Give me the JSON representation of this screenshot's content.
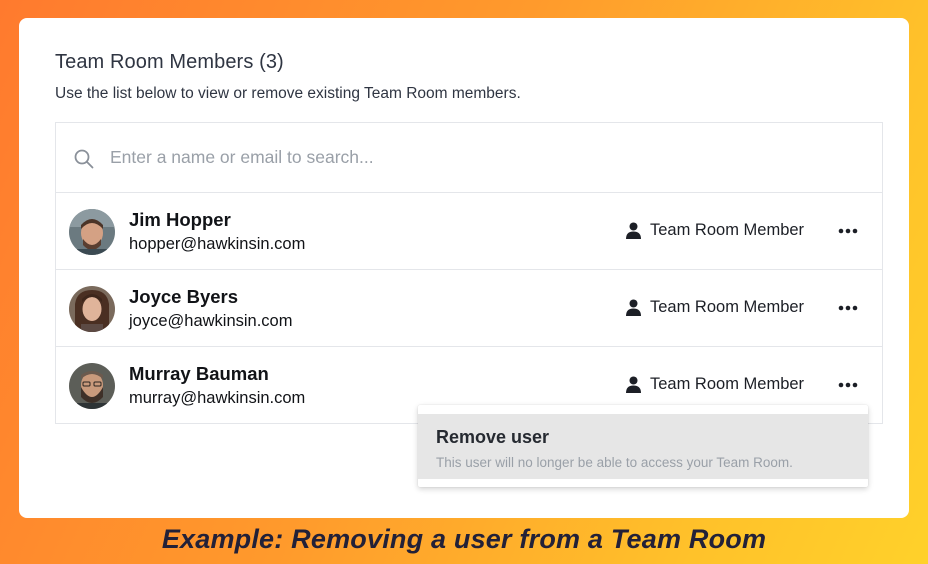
{
  "panel": {
    "title": "Team Room Members (3)",
    "subtitle": "Use the list below to view or remove existing Team Room members."
  },
  "search": {
    "icon": "search-icon",
    "placeholder": "Enter a name or email to search..."
  },
  "members": [
    {
      "name": "Jim Hopper",
      "email": "hopper@hawkinsin.com",
      "role": "Team Room Member",
      "role_icon": "user-icon"
    },
    {
      "name": "Joyce Byers",
      "email": "joyce@hawkinsin.com",
      "role": "Team Room Member",
      "role_icon": "user-icon"
    },
    {
      "name": "Murray Bauman",
      "email": "murray@hawkinsin.com",
      "role": "Team Room Member",
      "role_icon": "user-icon"
    }
  ],
  "dropdown": {
    "title": "Remove user",
    "description": "This user will no longer be able to access your Team Room."
  },
  "caption": "Example: Removing a user from a Team Room",
  "colors": {
    "background_start": "#ff7a2e",
    "background_end": "#ffd12a",
    "text_primary": "#111317",
    "text_muted": "#9aa0a8",
    "menu_highlight": "#e6e6e6",
    "caption": "#232138"
  }
}
